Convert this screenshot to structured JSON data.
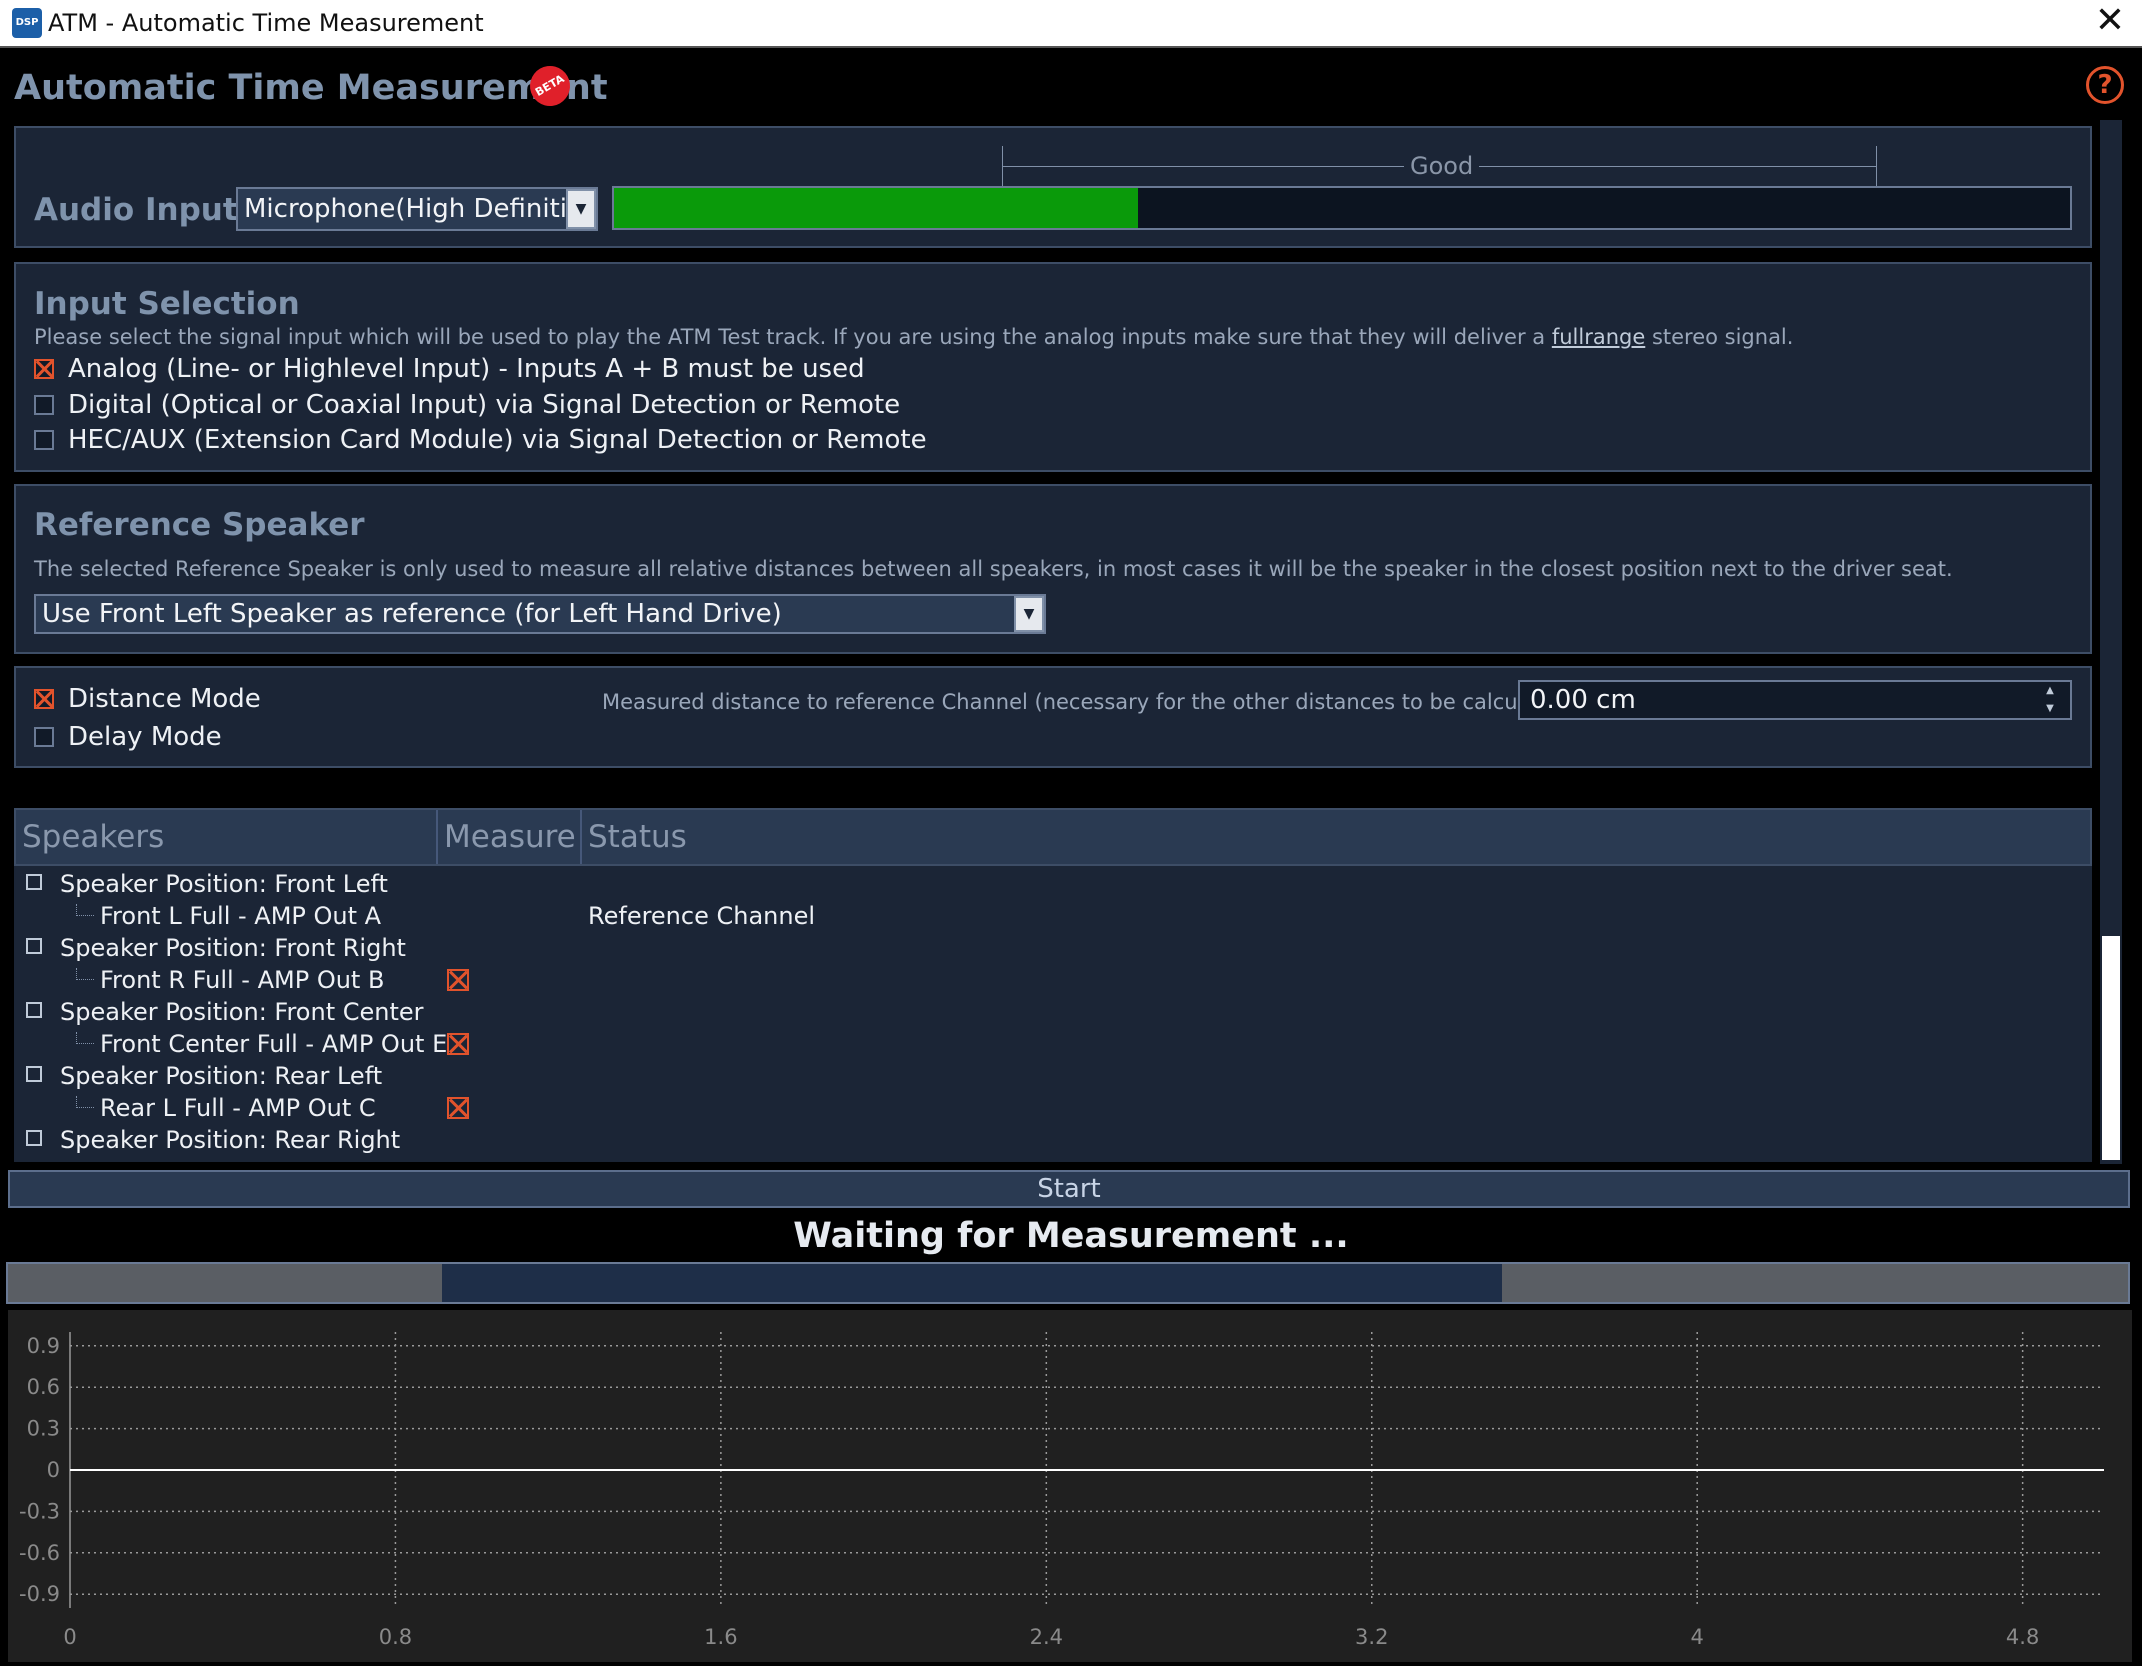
{
  "window": {
    "title": "ATM - Automatic Time Measurement",
    "icon": "dsp-app-icon",
    "close_glyph": "✕"
  },
  "app": {
    "heading": "Automatic Time Measurement",
    "beta_badge": "BETA",
    "help_glyph": "?"
  },
  "audio_input": {
    "label": "Audio Input:",
    "selected": "Microphone(High Definition Audio",
    "level_fraction": 0.36,
    "good_label": "Good"
  },
  "input_selection": {
    "title": "Input Selection",
    "description_pre": "Please select the signal input which will be used to play the ATM Test track. If you are using the analog inputs make sure that they will deliver a ",
    "description_link": "fullrange",
    "description_post": " stereo signal.",
    "options": [
      {
        "label": "Analog (Line- or Highlevel Input) - Inputs A + B must be used",
        "checked": true
      },
      {
        "label": "Digital (Optical or Coaxial Input) via Signal Detection or Remote",
        "checked": false
      },
      {
        "label": "HEC/AUX (Extension Card Module) via Signal Detection or Remote",
        "checked": false
      }
    ]
  },
  "reference_speaker": {
    "title": "Reference Speaker",
    "description": "The selected Reference Speaker is only used to measure all relative distances between all speakers, in most cases it will be the speaker in the closest position next to the driver seat.",
    "selected": "Use Front Left Speaker as reference (for Left Hand Drive)"
  },
  "mode": {
    "distance_label": "Distance Mode",
    "distance_checked": true,
    "delay_label": "Delay Mode",
    "delay_checked": false,
    "measured_label": "Measured distance to reference Channel (necessary for the other distances to be calculated):",
    "measured_value": "0.00 cm"
  },
  "table": {
    "headers": [
      "Speakers",
      "Measure",
      "Status"
    ],
    "rows": [
      {
        "level": 0,
        "label": "Speaker Position: Front Left",
        "measure": false,
        "status": ""
      },
      {
        "level": 1,
        "label": "Front L Full - AMP Out A",
        "measure": false,
        "status": "Reference Channel"
      },
      {
        "level": 0,
        "label": "Speaker Position: Front Right",
        "measure": false,
        "status": ""
      },
      {
        "level": 1,
        "label": "Front R Full - AMP Out B",
        "measure": true,
        "status": ""
      },
      {
        "level": 0,
        "label": "Speaker Position: Front Center",
        "measure": false,
        "status": ""
      },
      {
        "level": 1,
        "label": "Front Center Full - AMP Out E",
        "measure": true,
        "status": ""
      },
      {
        "level": 0,
        "label": "Speaker Position: Rear Left",
        "measure": false,
        "status": ""
      },
      {
        "level": 1,
        "label": "Rear L Full - AMP Out C",
        "measure": true,
        "status": ""
      },
      {
        "level": 0,
        "label": "Speaker Position: Rear Right",
        "measure": false,
        "status": ""
      }
    ]
  },
  "start_label": "Start",
  "status_text": "Waiting for Measurement ...",
  "chart_data": {
    "type": "line",
    "x_ticks": [
      "0",
      "0.8",
      "1.6",
      "2.4",
      "3.2",
      "4",
      "4.8"
    ],
    "y_ticks": [
      "0.9",
      "0.6",
      "0.3",
      "0",
      "-0.3",
      "-0.6",
      "-0.9"
    ],
    "xlim": [
      0,
      5
    ],
    "ylim": [
      -1,
      1
    ],
    "grid": true,
    "series": [
      {
        "x": [
          0,
          5
        ],
        "y": [
          0,
          0
        ],
        "color": "#ffffff"
      }
    ]
  }
}
